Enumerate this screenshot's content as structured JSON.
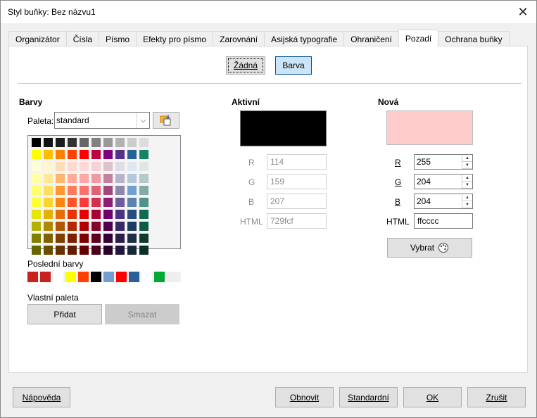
{
  "window": {
    "title": "Styl buňky: Bez názvu1",
    "close_glyph": "✕"
  },
  "tabs": [
    {
      "label": "Organizátor"
    },
    {
      "label": "Čísla"
    },
    {
      "label": "Písmo"
    },
    {
      "label": "Efekty pro písmo"
    },
    {
      "label": "Zarovnání"
    },
    {
      "label": "Asijská typografie"
    },
    {
      "label": "Ohraničení"
    },
    {
      "label": "Pozadí",
      "active": true
    },
    {
      "label": "Ochrana buňky"
    }
  ],
  "fill_buttons": {
    "none": "Žádná",
    "color": "Barva"
  },
  "colors_section": {
    "heading": "Barvy",
    "palette_label": "Paleta:",
    "palette_value": "standard",
    "recent_label": "Poslední barvy",
    "custom_label": "Vlastní paleta",
    "add_button": "Přidat",
    "delete_button": "Smazat",
    "palette_rows": [
      [
        "#000000",
        "#111111",
        "#1c1c1c",
        "#333333",
        "#666666",
        "#808080",
        "#999999",
        "#b2b2b2",
        "#cccccc",
        "#dddddd",
        "#eeeeee",
        "#ffffff"
      ],
      [
        "#ffff00",
        "#ffbf00",
        "#ff8000",
        "#ff4000",
        "#ff0000",
        "#bf0041",
        "#800080",
        "#55308d",
        "#2a6099",
        "#158466",
        "#00a933",
        "#81d41a"
      ],
      [
        "#ffffd7",
        "#fff5ce",
        "#ffdbb6",
        "#ffd8ce",
        "#ffd7d7",
        "#f7d1d5",
        "#e0c2cd",
        "#dedce6",
        "#dee6ef",
        "#dee7e5",
        "#dde8cb",
        "#f6f9d4"
      ],
      [
        "#ffffa6",
        "#ffe994",
        "#ffb66c",
        "#ffaa95",
        "#ffa6a6",
        "#ec9ba4",
        "#bf819e",
        "#b7b3ca",
        "#b4c7dc",
        "#b3cac7",
        "#afd095",
        "#e8f2a1"
      ],
      [
        "#ffff6d",
        "#ffde59",
        "#ff972f",
        "#ff7b59",
        "#ff6d6d",
        "#e16173",
        "#a1467e",
        "#8e86ae",
        "#729fcf",
        "#81aca6",
        "#77bc65",
        "#d4ea6b"
      ],
      [
        "#ffff38",
        "#ffd428",
        "#ff860d",
        "#ff5429",
        "#ff3838",
        "#d62e4e",
        "#8d1d75",
        "#6b5e9b",
        "#5983b0",
        "#50938a",
        "#3faf46",
        "#c9e228"
      ],
      [
        "#e6e600",
        "#e6b000",
        "#e66e00",
        "#e63500",
        "#e60000",
        "#ab0036",
        "#6f006f",
        "#483480",
        "#2a4d80",
        "#0e6b52",
        "#008d29",
        "#6ea90d"
      ],
      [
        "#b2b200",
        "#b28800",
        "#b25500",
        "#b22900",
        "#b20000",
        "#85002a",
        "#4e004e",
        "#3a2766",
        "#1c3d61",
        "#0e5c46",
        "#006e1f",
        "#4f7a0d"
      ],
      [
        "#808000",
        "#806000",
        "#803e00",
        "#801f00",
        "#800000",
        "#5c001d",
        "#350035",
        "#2c1d4d",
        "#1c2d45",
        "#0d3d30",
        "#004d15",
        "#3c5a0f"
      ],
      [
        "#666600",
        "#665000",
        "#663300",
        "#661a00",
        "#660000",
        "#4a0017",
        "#2a002a",
        "#231740",
        "#162838",
        "#0b3126",
        "#003e11",
        "#2f4810"
      ]
    ],
    "recent_colors": [
      "#c9211e",
      "#c9211e",
      "#ffffff",
      "#ffff00",
      "#ff4000",
      "#000000",
      "#729fcf",
      "#ff0000",
      "#2a6099",
      "#ffffff",
      "#00a933",
      "#eeeeee"
    ]
  },
  "active_section": {
    "heading": "Aktivní",
    "swatch": "#000000",
    "r_label": "R",
    "r": "114",
    "g_label": "G",
    "g": "159",
    "b_label": "B",
    "b": "207",
    "html_label": "HTML",
    "html": "729fcf"
  },
  "new_section": {
    "heading": "Nová",
    "swatch": "#ffcccc",
    "r_label": "R",
    "r": "255",
    "g_label": "G",
    "g": "204",
    "b_label": "B",
    "b": "204",
    "html_label": "HTML",
    "html": "ffcccc",
    "pick_button": "Vybrat"
  },
  "footer": {
    "help": "Nápověda",
    "reset": "Obnovit",
    "standard": "Standardní",
    "ok": "OK",
    "cancel": "Zrušit"
  }
}
